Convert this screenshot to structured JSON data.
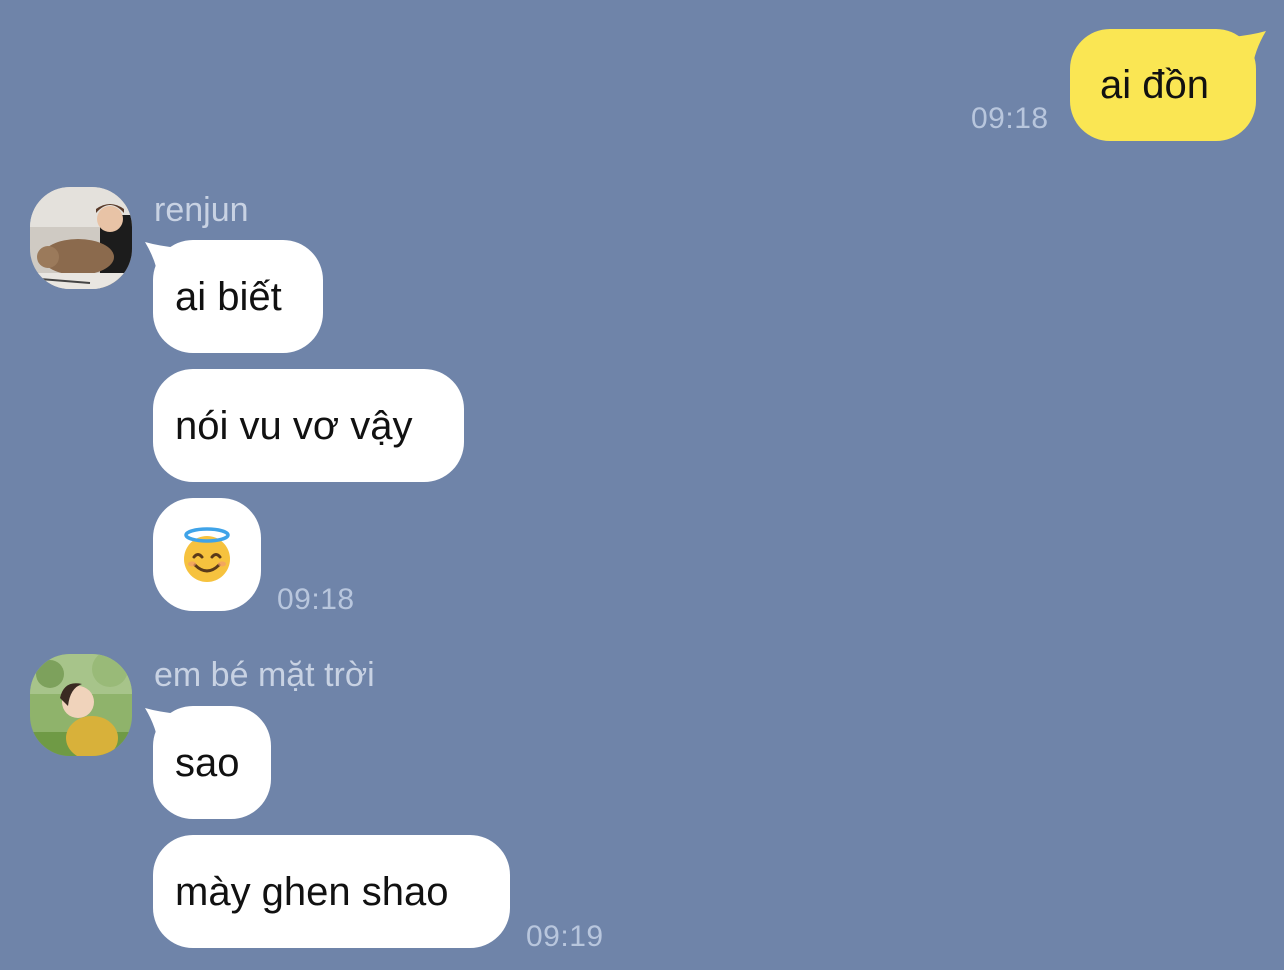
{
  "colors": {
    "background": "#6f84a9",
    "outgoing_bubble": "#fae653",
    "incoming_bubble": "#ffffff",
    "timestamp": "#b8c6dd",
    "sender_name": "#c8d2e3"
  },
  "messages": {
    "out1": {
      "text": "ai đồn",
      "time": "09:18"
    },
    "group1": {
      "sender": "renjun",
      "avatar_icon": "person-with-dog-avatar",
      "m1": "ai biết",
      "m2": "nói vu vơ vậy",
      "m3_emoji": "😇",
      "emoji_icon": "smiling-face-with-halo-icon",
      "time": "09:18"
    },
    "group2": {
      "sender": "em bé mặt trời",
      "avatar_icon": "person-in-field-avatar",
      "m1": "sao",
      "m2": "mày ghen shao",
      "time": "09:19"
    }
  }
}
